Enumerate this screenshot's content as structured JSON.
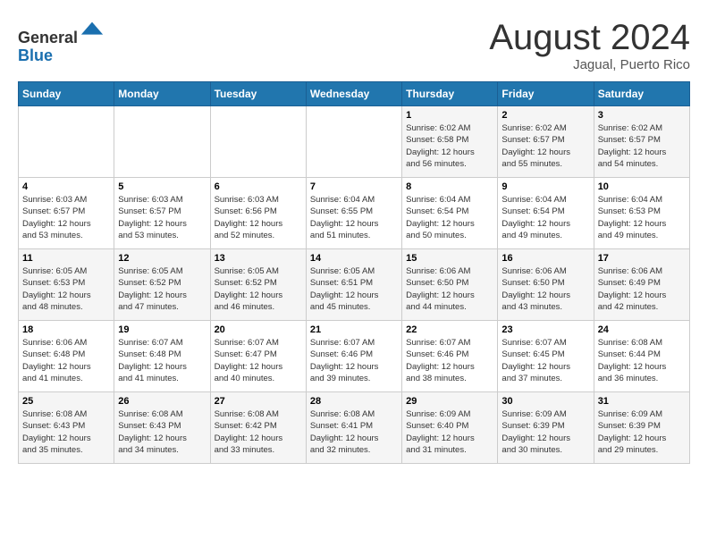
{
  "header": {
    "logo_line1": "General",
    "logo_line2": "Blue",
    "month_title": "August 2024",
    "location": "Jagual, Puerto Rico"
  },
  "days_of_week": [
    "Sunday",
    "Monday",
    "Tuesday",
    "Wednesday",
    "Thursday",
    "Friday",
    "Saturday"
  ],
  "weeks": [
    [
      {
        "day": "",
        "info": ""
      },
      {
        "day": "",
        "info": ""
      },
      {
        "day": "",
        "info": ""
      },
      {
        "day": "",
        "info": ""
      },
      {
        "day": "1",
        "info": "Sunrise: 6:02 AM\nSunset: 6:58 PM\nDaylight: 12 hours\nand 56 minutes."
      },
      {
        "day": "2",
        "info": "Sunrise: 6:02 AM\nSunset: 6:57 PM\nDaylight: 12 hours\nand 55 minutes."
      },
      {
        "day": "3",
        "info": "Sunrise: 6:02 AM\nSunset: 6:57 PM\nDaylight: 12 hours\nand 54 minutes."
      }
    ],
    [
      {
        "day": "4",
        "info": "Sunrise: 6:03 AM\nSunset: 6:57 PM\nDaylight: 12 hours\nand 53 minutes."
      },
      {
        "day": "5",
        "info": "Sunrise: 6:03 AM\nSunset: 6:57 PM\nDaylight: 12 hours\nand 53 minutes."
      },
      {
        "day": "6",
        "info": "Sunrise: 6:03 AM\nSunset: 6:56 PM\nDaylight: 12 hours\nand 52 minutes."
      },
      {
        "day": "7",
        "info": "Sunrise: 6:04 AM\nSunset: 6:55 PM\nDaylight: 12 hours\nand 51 minutes."
      },
      {
        "day": "8",
        "info": "Sunrise: 6:04 AM\nSunset: 6:54 PM\nDaylight: 12 hours\nand 50 minutes."
      },
      {
        "day": "9",
        "info": "Sunrise: 6:04 AM\nSunset: 6:54 PM\nDaylight: 12 hours\nand 49 minutes."
      },
      {
        "day": "10",
        "info": "Sunrise: 6:04 AM\nSunset: 6:53 PM\nDaylight: 12 hours\nand 49 minutes."
      }
    ],
    [
      {
        "day": "11",
        "info": "Sunrise: 6:05 AM\nSunset: 6:53 PM\nDaylight: 12 hours\nand 48 minutes."
      },
      {
        "day": "12",
        "info": "Sunrise: 6:05 AM\nSunset: 6:52 PM\nDaylight: 12 hours\nand 47 minutes."
      },
      {
        "day": "13",
        "info": "Sunrise: 6:05 AM\nSunset: 6:52 PM\nDaylight: 12 hours\nand 46 minutes."
      },
      {
        "day": "14",
        "info": "Sunrise: 6:05 AM\nSunset: 6:51 PM\nDaylight: 12 hours\nand 45 minutes."
      },
      {
        "day": "15",
        "info": "Sunrise: 6:06 AM\nSunset: 6:50 PM\nDaylight: 12 hours\nand 44 minutes."
      },
      {
        "day": "16",
        "info": "Sunrise: 6:06 AM\nSunset: 6:50 PM\nDaylight: 12 hours\nand 43 minutes."
      },
      {
        "day": "17",
        "info": "Sunrise: 6:06 AM\nSunset: 6:49 PM\nDaylight: 12 hours\nand 42 minutes."
      }
    ],
    [
      {
        "day": "18",
        "info": "Sunrise: 6:06 AM\nSunset: 6:48 PM\nDaylight: 12 hours\nand 41 minutes."
      },
      {
        "day": "19",
        "info": "Sunrise: 6:07 AM\nSunset: 6:48 PM\nDaylight: 12 hours\nand 41 minutes."
      },
      {
        "day": "20",
        "info": "Sunrise: 6:07 AM\nSunset: 6:47 PM\nDaylight: 12 hours\nand 40 minutes."
      },
      {
        "day": "21",
        "info": "Sunrise: 6:07 AM\nSunset: 6:46 PM\nDaylight: 12 hours\nand 39 minutes."
      },
      {
        "day": "22",
        "info": "Sunrise: 6:07 AM\nSunset: 6:46 PM\nDaylight: 12 hours\nand 38 minutes."
      },
      {
        "day": "23",
        "info": "Sunrise: 6:07 AM\nSunset: 6:45 PM\nDaylight: 12 hours\nand 37 minutes."
      },
      {
        "day": "24",
        "info": "Sunrise: 6:08 AM\nSunset: 6:44 PM\nDaylight: 12 hours\nand 36 minutes."
      }
    ],
    [
      {
        "day": "25",
        "info": "Sunrise: 6:08 AM\nSunset: 6:43 PM\nDaylight: 12 hours\nand 35 minutes."
      },
      {
        "day": "26",
        "info": "Sunrise: 6:08 AM\nSunset: 6:43 PM\nDaylight: 12 hours\nand 34 minutes."
      },
      {
        "day": "27",
        "info": "Sunrise: 6:08 AM\nSunset: 6:42 PM\nDaylight: 12 hours\nand 33 minutes."
      },
      {
        "day": "28",
        "info": "Sunrise: 6:08 AM\nSunset: 6:41 PM\nDaylight: 12 hours\nand 32 minutes."
      },
      {
        "day": "29",
        "info": "Sunrise: 6:09 AM\nSunset: 6:40 PM\nDaylight: 12 hours\nand 31 minutes."
      },
      {
        "day": "30",
        "info": "Sunrise: 6:09 AM\nSunset: 6:39 PM\nDaylight: 12 hours\nand 30 minutes."
      },
      {
        "day": "31",
        "info": "Sunrise: 6:09 AM\nSunset: 6:39 PM\nDaylight: 12 hours\nand 29 minutes."
      }
    ]
  ]
}
